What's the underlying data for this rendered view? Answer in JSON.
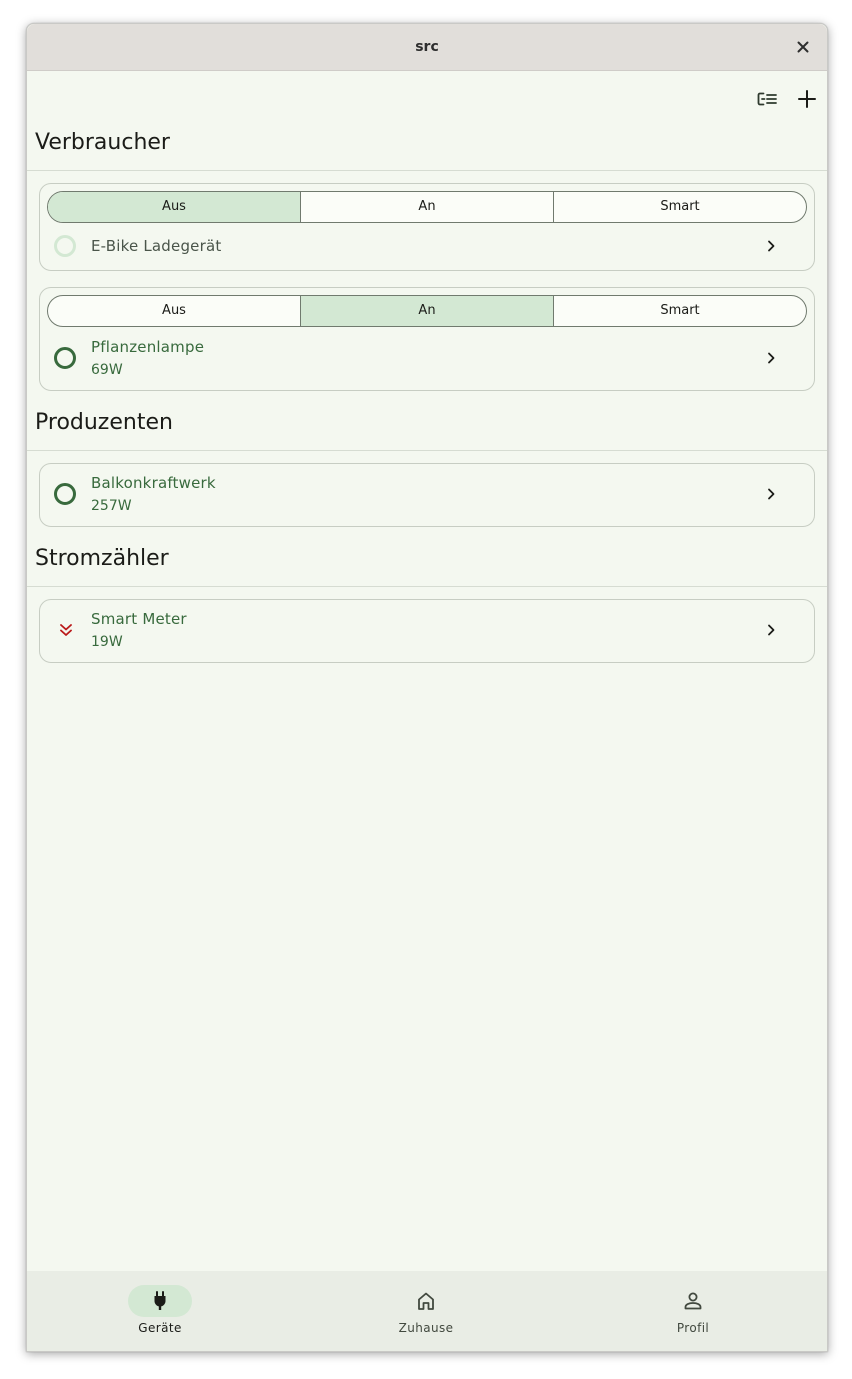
{
  "window": {
    "title": "src"
  },
  "toolbar": {
    "filter_icon": "filter-list-icon",
    "add_icon": "add-icon"
  },
  "sections": {
    "consumers": {
      "title": "Verbraucher",
      "devices": [
        {
          "modes": [
            "Aus",
            "An",
            "Smart"
          ],
          "selected_mode": "Aus",
          "name": "E-Bike Ladegerät",
          "power": "",
          "state": "off"
        },
        {
          "modes": [
            "Aus",
            "An",
            "Smart"
          ],
          "selected_mode": "An",
          "name": "Pflanzenlampe",
          "power": "69W",
          "state": "on"
        }
      ]
    },
    "producers": {
      "title": "Produzenten",
      "devices": [
        {
          "name": "Balkonkraftwerk",
          "power": "257W",
          "state": "on"
        }
      ]
    },
    "meters": {
      "title": "Stromzähler",
      "devices": [
        {
          "name": "Smart Meter",
          "power": "19W",
          "icon": "double-chevron-down-icon"
        }
      ]
    }
  },
  "bottom_nav": {
    "items": [
      {
        "label": "Geräte",
        "icon": "plug-icon",
        "active": true
      },
      {
        "label": "Zuhause",
        "icon": "home-icon",
        "active": false
      },
      {
        "label": "Profil",
        "icon": "person-icon",
        "active": false
      }
    ]
  },
  "colors": {
    "primary": "#386a3d",
    "selected_container": "#d3e8d3",
    "background": "#f4f8f0",
    "grid_import": "#ba1a1a"
  }
}
